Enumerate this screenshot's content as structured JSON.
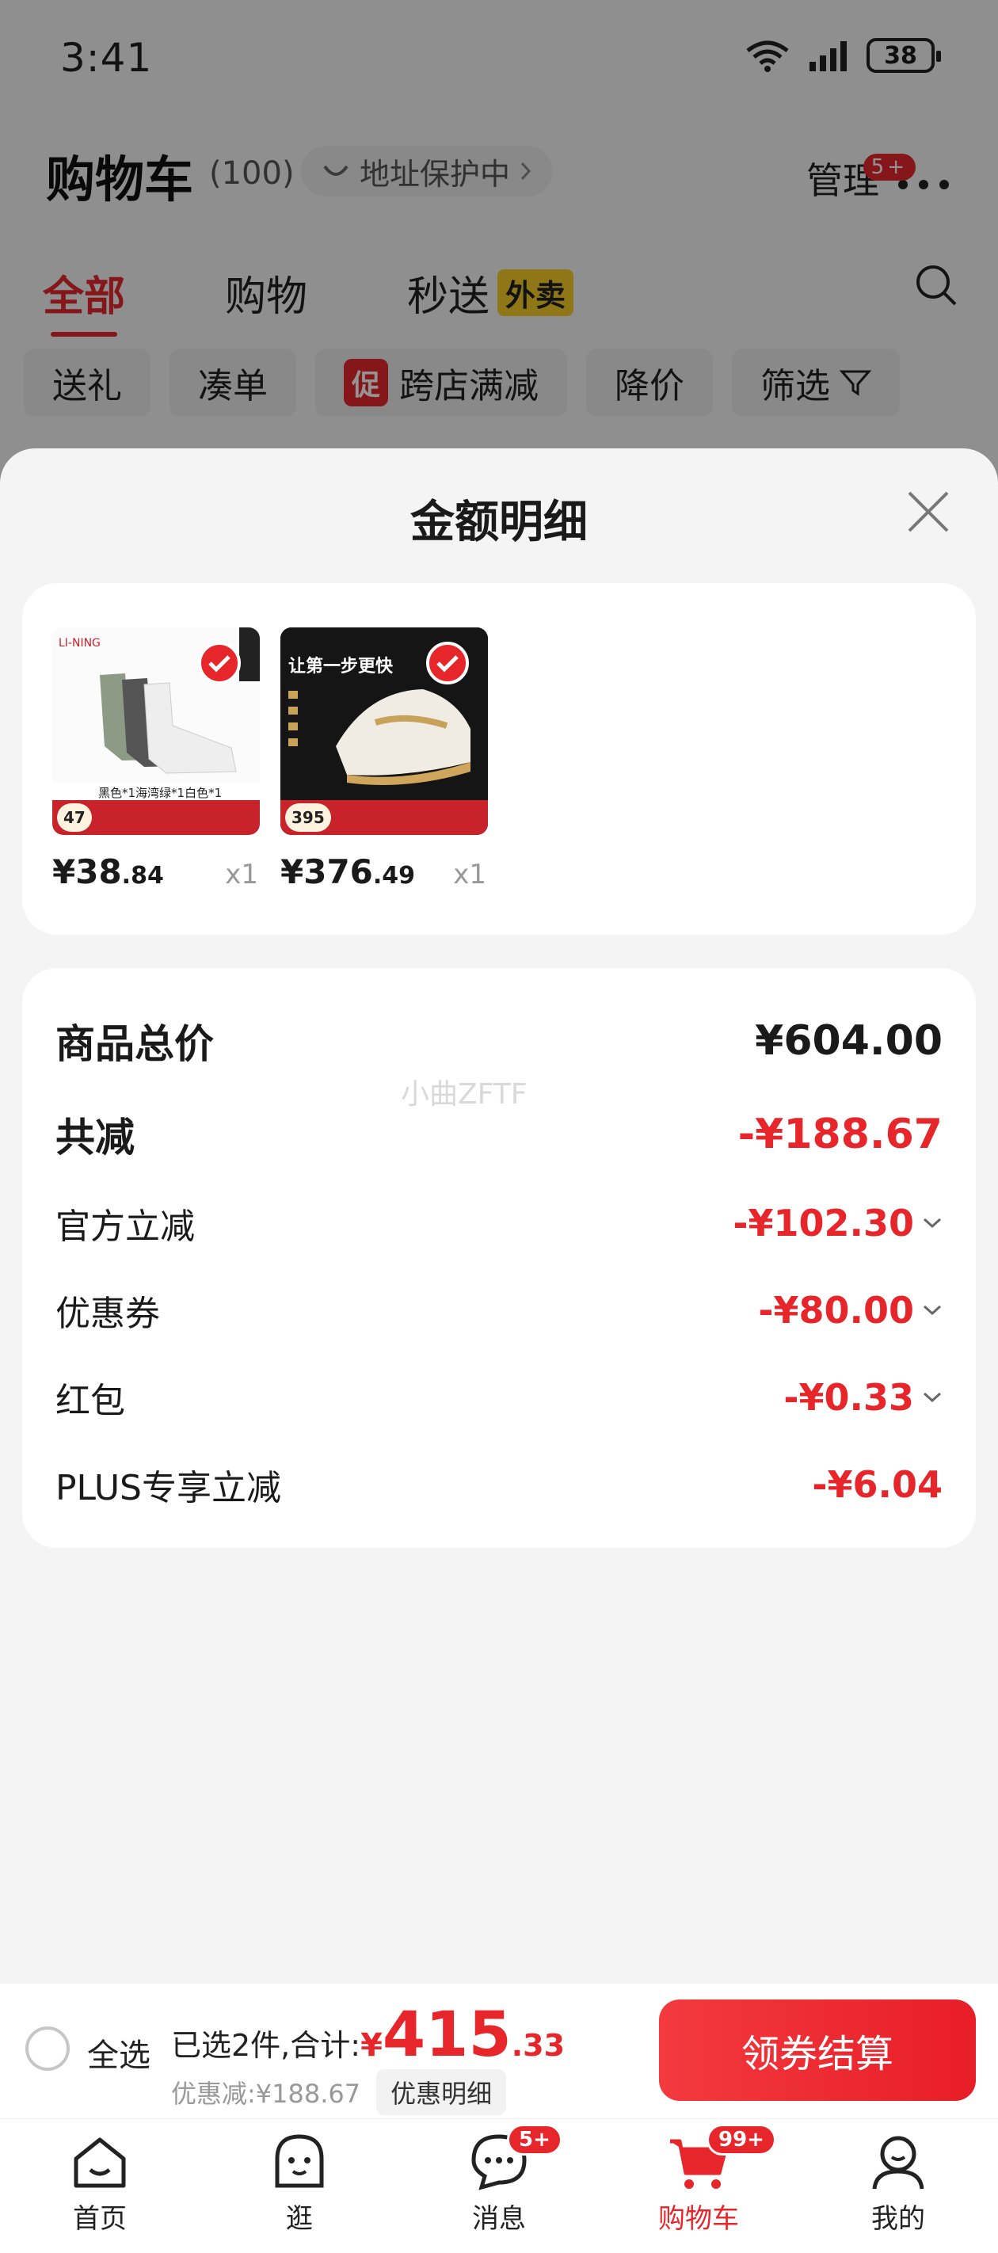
{
  "status_bar": {
    "time": "3:41",
    "battery": "38"
  },
  "header": {
    "title": "购物车",
    "count": "(100)",
    "address": "地址保护中",
    "manage": "管理",
    "more_badge": "5+"
  },
  "tabs": [
    {
      "label": "全部",
      "active": true
    },
    {
      "label": "购物"
    },
    {
      "label": "秒送",
      "badge": "外卖"
    }
  ],
  "chips": [
    "送礼",
    "凑单",
    "跨店满减",
    "降价",
    "筛选"
  ],
  "chip_promo": "促",
  "sheet": {
    "title": "金额明细",
    "products": [
      {
        "price_int": "¥38",
        "price_dec": ".84",
        "qty": "x1",
        "img_price": "47"
      },
      {
        "price_int": "¥376",
        "price_dec": ".49",
        "qty": "x1",
        "img_price": "395"
      }
    ],
    "summary": {
      "watermark": "小曲ZFTF",
      "total_label": "商品总价",
      "total_value": "¥604.00",
      "discount_label": "共减",
      "discount_value": "-¥188.67",
      "rows": [
        {
          "label": "官方立减",
          "value": "-¥102.30"
        },
        {
          "label": "优惠券",
          "value": "-¥80.00"
        },
        {
          "label": "红包",
          "value": "-¥0.33"
        },
        {
          "label": "PLUS专享立减",
          "value": "-¥6.04"
        }
      ]
    }
  },
  "checkout": {
    "select_all": "全选",
    "selected_text": "已选2件,合计:",
    "total_currency": "¥",
    "total_int": "415",
    "total_dec": ".33",
    "discount_text": "优惠减:¥188.67",
    "detail_button": "优惠明细",
    "checkout_button": "领券结算"
  },
  "bottom_nav": [
    {
      "label": "首页"
    },
    {
      "label": "逛"
    },
    {
      "label": "消息",
      "badge": "5+"
    },
    {
      "label": "购物车",
      "badge": "99+",
      "active": true
    },
    {
      "label": "我的"
    }
  ],
  "colors": {
    "accent": "#e6262b",
    "badge_yellow": "#f7cd2a"
  }
}
